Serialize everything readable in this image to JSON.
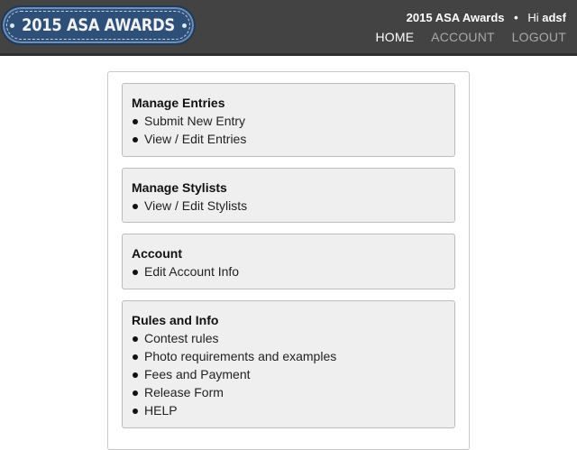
{
  "header": {
    "logo_text": "2015 ASA AWARDS",
    "app_name": "2015 ASA Awards",
    "separator": "•",
    "greeting": "Hi",
    "username": "adsf",
    "nav": {
      "home": "HOME",
      "account": "ACCOUNT",
      "logout": "LOGOUT"
    }
  },
  "sections": {
    "entries": {
      "title": "Manage Entries",
      "items": [
        "Submit New Entry",
        "View / Edit Entries"
      ]
    },
    "stylists": {
      "title": "Manage Stylists",
      "items": [
        "View / Edit Stylists"
      ]
    },
    "account": {
      "title": "Account",
      "items": [
        "Edit Account Info"
      ]
    },
    "rules": {
      "title": "Rules and Info",
      "items": [
        "Contest rules",
        "Photo requirements and examples",
        "Fees and Payment",
        "Release Form",
        "HELP"
      ]
    }
  }
}
